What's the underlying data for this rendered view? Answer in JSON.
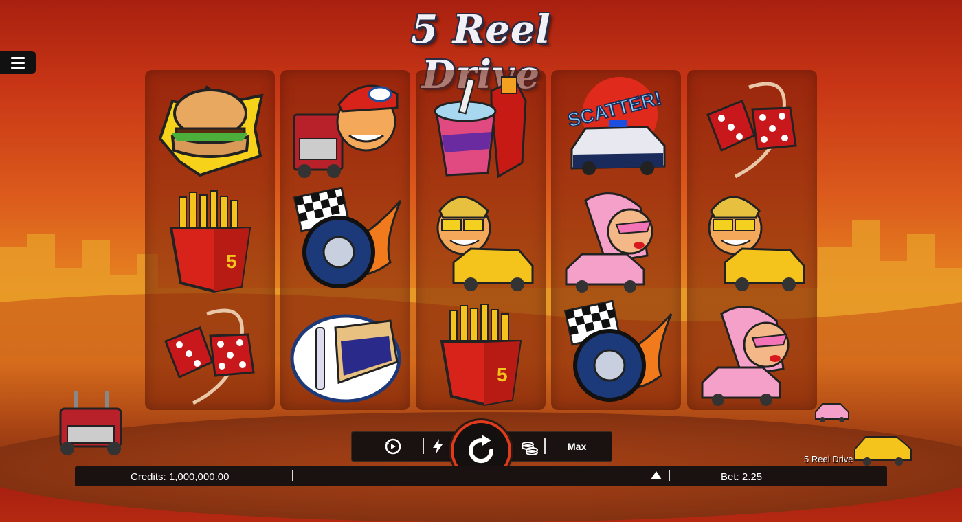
{
  "game": {
    "title": "5 Reel Drive",
    "brand_label": "5 Reel Drive"
  },
  "colors": {
    "sky_top": "#a8200f",
    "sky_mid": "#e88a22",
    "accent_red": "#e03a1c",
    "bar_bg": "#1a1210"
  },
  "reels": [
    {
      "symbols": [
        "burger",
        "fries",
        "dice"
      ]
    },
    {
      "symbols": [
        "trucker",
        "racing-wheel",
        "pie"
      ]
    },
    {
      "symbols": [
        "soda",
        "taxi-driver",
        "fries"
      ]
    },
    {
      "symbols": [
        "police-car-scatter",
        "pink-lady",
        "racing-wheel"
      ]
    },
    {
      "symbols": [
        "dice",
        "taxi-driver",
        "pink-lady"
      ]
    }
  ],
  "scatter_text": "SCATTER!",
  "controls": {
    "autoplay_icon": "autoplay-icon",
    "turbo_icon": "lightning-icon",
    "spin_icon": "spin-icon",
    "coins_icon": "coins-icon",
    "max_label": "Max"
  },
  "status": {
    "credits": "Credits: 1,000,000.00",
    "bet": "Bet: 2.25"
  }
}
